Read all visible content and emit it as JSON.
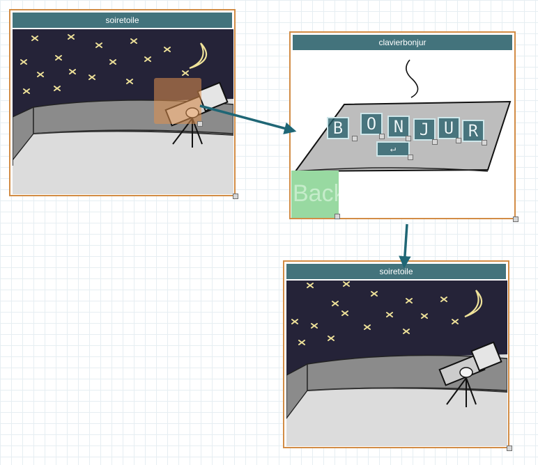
{
  "cards": {
    "top_left": {
      "title": "soiretoile"
    },
    "top_right": {
      "title": "clavierbonjur"
    },
    "bottom": {
      "title": "soiretoile"
    }
  },
  "keyboard": {
    "keys": [
      "B",
      "O",
      "N",
      "J",
      "U",
      "R"
    ],
    "enter_key": "↵"
  },
  "back_button": {
    "label": "Back"
  },
  "colors": {
    "frame_border": "#d28c45",
    "title_bar": "#43737c",
    "arrow": "#1f6675",
    "hotspot": "#e2924e",
    "back_hotspot": "#98d9a1",
    "night_sky": "#252338",
    "star": "#f0e39a"
  }
}
